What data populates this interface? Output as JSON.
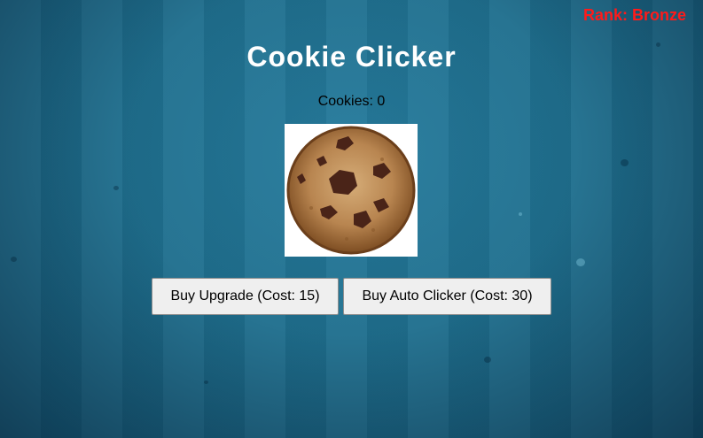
{
  "game": {
    "title": "Cookie Clicker",
    "rank_text": "Rank: Bronze",
    "cookies_text": "Cookies: 0",
    "cookie_icon": "cookie-icon"
  },
  "buttons": {
    "upgrade_label": "Buy Upgrade (Cost: 15)",
    "auto_clicker_label": "Buy Auto Clicker (Cost: 30)"
  },
  "colors": {
    "background": "#1f6f8e",
    "rank": "#ff1a1a",
    "title": "#ffffff",
    "button_bg": "#efefef"
  }
}
